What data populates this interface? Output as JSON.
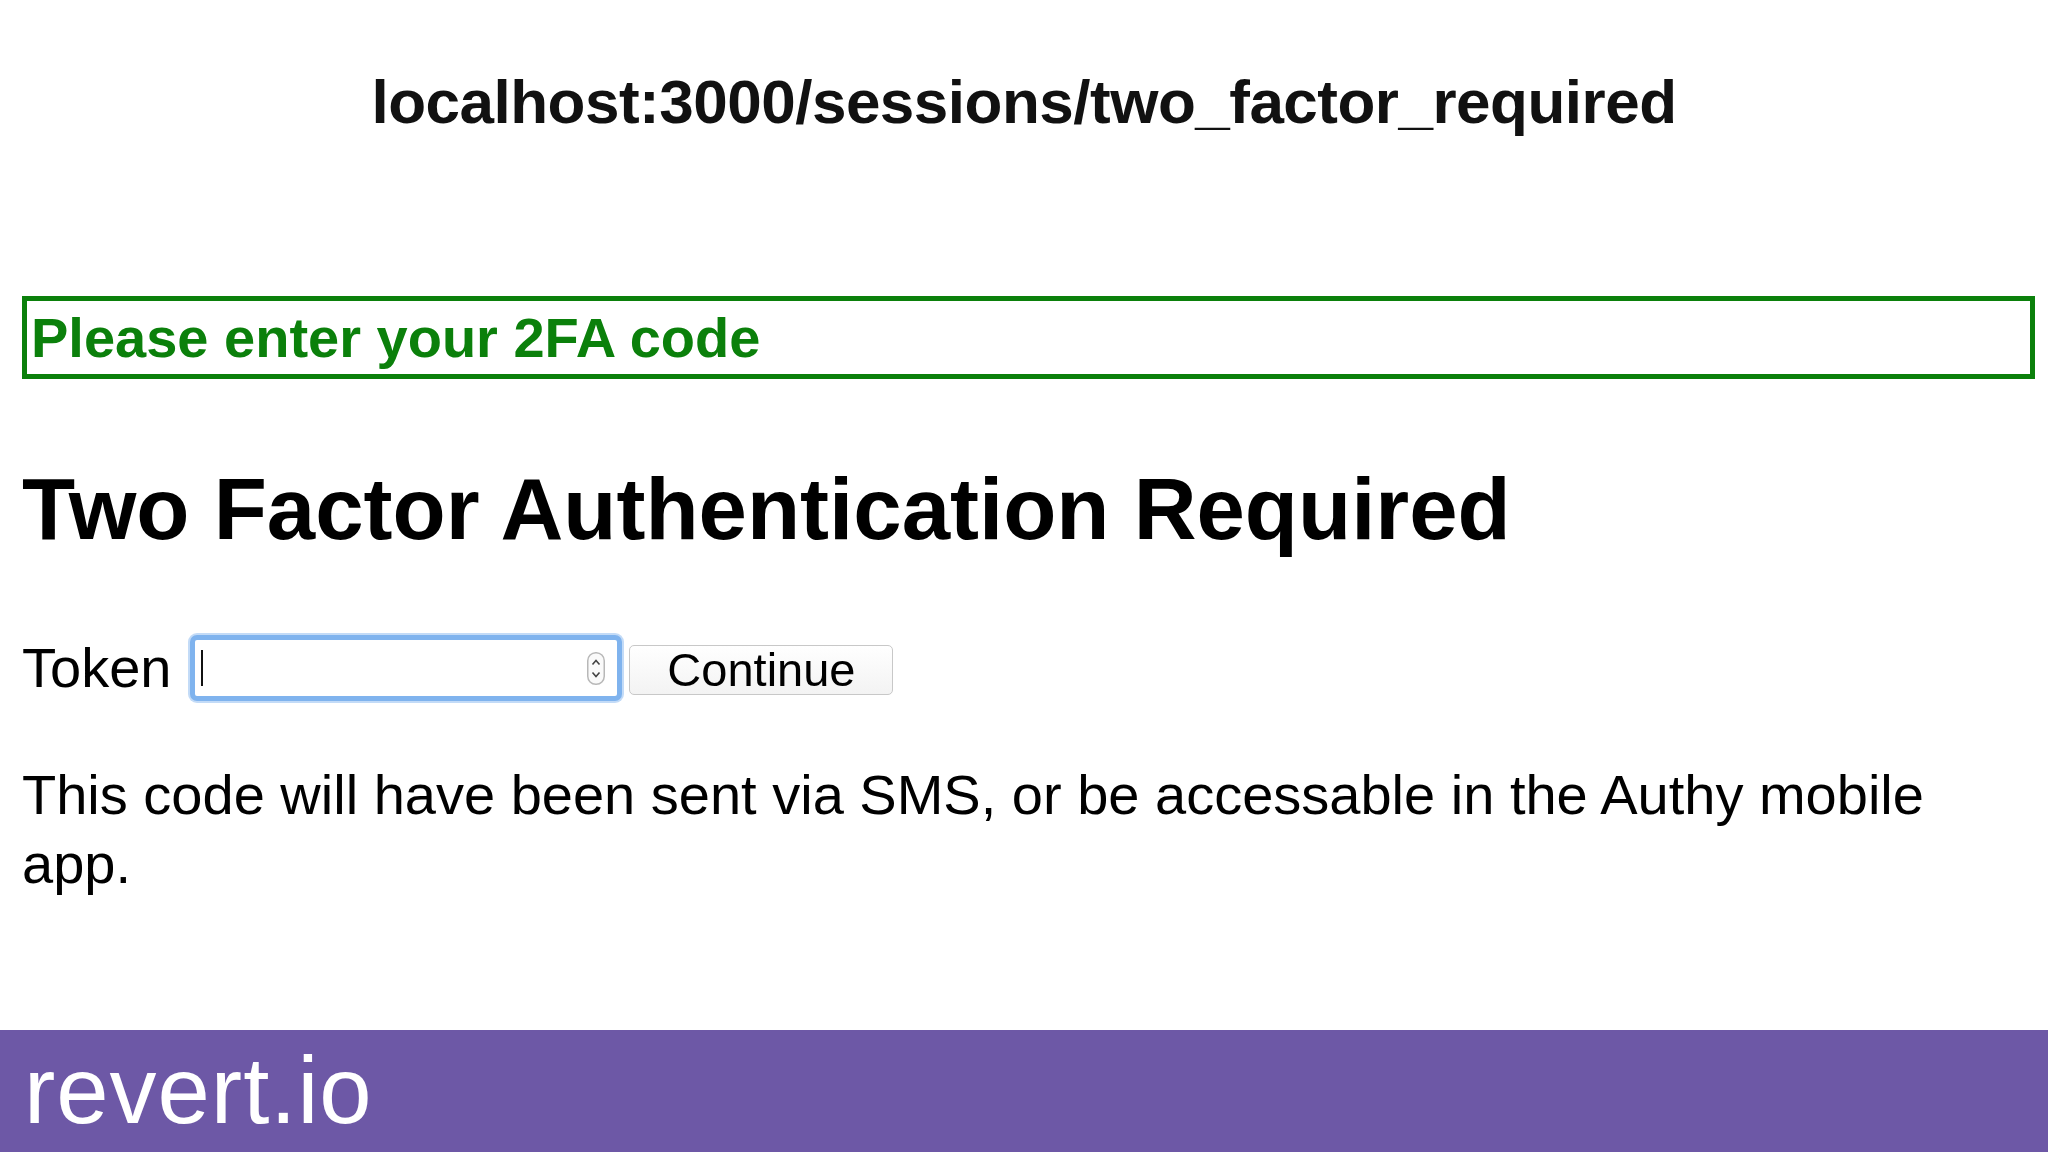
{
  "page_title": "localhost:3000/sessions/two_factor_required",
  "flash": {
    "kind": "notice",
    "message": "Please enter your 2FA code"
  },
  "heading": "Two Factor Authentication Required",
  "form": {
    "label": "Token",
    "token_field": {
      "focused": true
    },
    "submit_button": "Continue"
  },
  "help_text": "This code will have been sent via SMS, or be accessable in the Authy mobile app.",
  "footer": {
    "logo": "revert.io"
  }
}
